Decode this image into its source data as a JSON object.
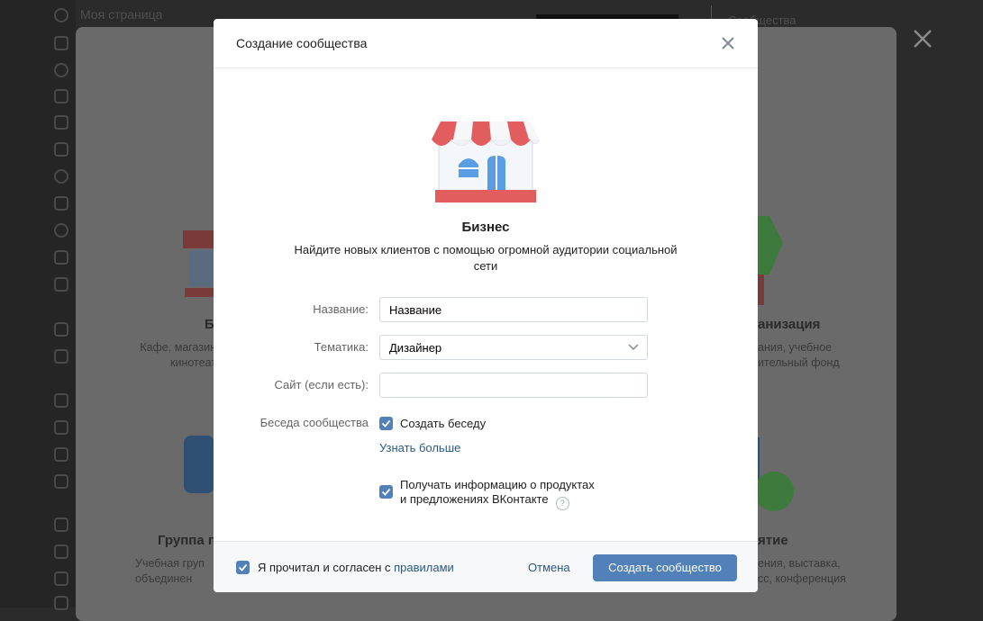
{
  "background": {
    "my_page": "Моя страница",
    "communities": "Сообщества",
    "cards": [
      {
        "title": "Б",
        "desc": "Кафе, магазин\nкинотеат"
      },
      {
        "title": "анизация",
        "desc": "ания, учебное\nительный фонд"
      },
      {
        "title": "Группа п",
        "desc": "Учебная груп\nобъединен"
      },
      {
        "title": "ятие",
        "desc": "ения, выставка,\nсс, конференция"
      }
    ]
  },
  "modal": {
    "title": "Создание сообщества",
    "type_title": "Бизнес",
    "type_desc": "Найдите новых клиентов с помощью огромной аудитории социальной сети",
    "fields": {
      "name_label": "Название:",
      "name_value": "Название",
      "topic_label": "Тематика:",
      "topic_value": "Дизайнер",
      "site_label": "Сайт (если есть):",
      "site_value": "",
      "chat_label": "Беседа сообщества"
    },
    "create_chat_label": "Создать беседу",
    "learn_more": "Узнать больше",
    "info_line1": "Получать информацию о продуктах",
    "info_line2": "и предложениях ВКонтакте",
    "help_symbol": "?",
    "footer": {
      "agree_prefix": "Я прочитал и согласен с ",
      "agree_link": "правилами",
      "cancel": "Отмена",
      "create": "Создать сообщество"
    }
  },
  "colors": {
    "accent": "#5181b8",
    "link": "#2a5885",
    "awning_red": "#e25d5d"
  }
}
